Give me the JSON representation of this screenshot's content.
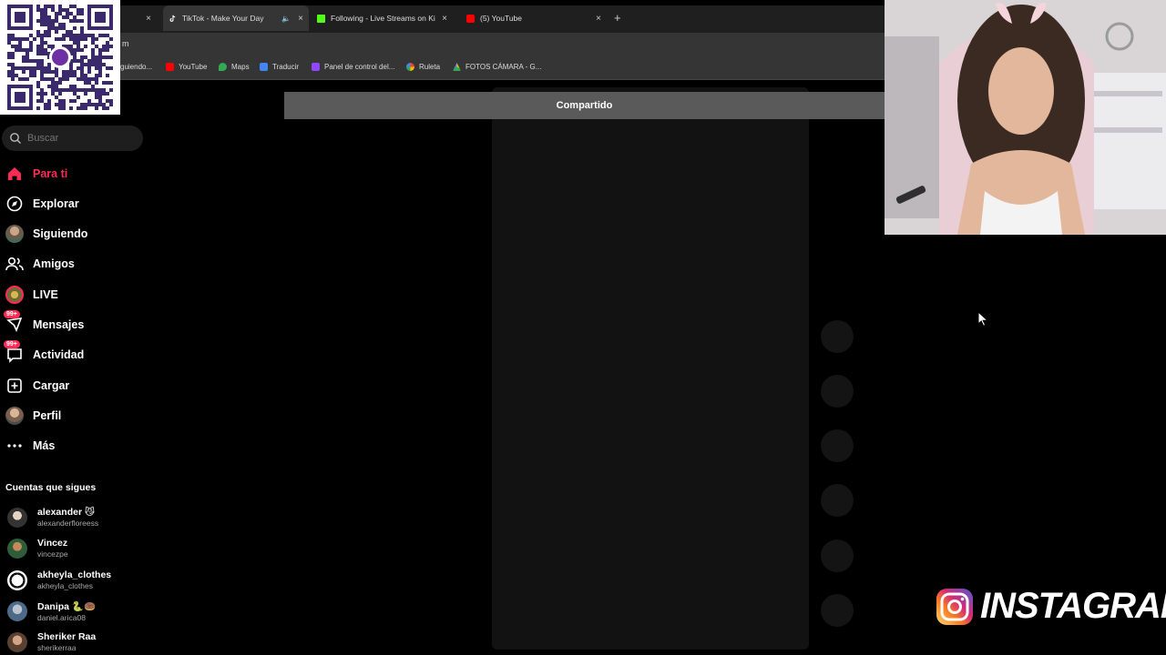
{
  "browser": {
    "tabs": [
      {
        "title": "",
        "active": false
      },
      {
        "title": "TikTok - Make Your Day",
        "active": true
      },
      {
        "title": "Following - Live Streams on Ki",
        "active": false
      },
      {
        "title": "(5) YouTube",
        "active": false
      }
    ],
    "close_glyph": "×",
    "new_tab_glyph": "+",
    "address_fragment": "m",
    "bookmarks": [
      {
        "label": "guiendo...",
        "color": "#fe2c55"
      },
      {
        "label": "YouTube",
        "color": "#ff0000"
      },
      {
        "label": "Maps",
        "color": "#34a853"
      },
      {
        "label": "Traducir",
        "color": "#4285f4"
      },
      {
        "label": "Panel de control del...",
        "color": "#9146ff"
      },
      {
        "label": "Ruleta",
        "color": "#ea4335"
      },
      {
        "label": "FOTOS CÁMARA - G...",
        "color": "#fbbc04"
      }
    ]
  },
  "sidebar": {
    "search_placeholder": "Buscar",
    "nav": [
      {
        "label": "Para ti",
        "icon": "home-icon",
        "active": true
      },
      {
        "label": "Explorar",
        "icon": "compass-icon"
      },
      {
        "label": "Siguiendo",
        "icon": "following-avatar-icon"
      },
      {
        "label": "Amigos",
        "icon": "friends-icon"
      },
      {
        "label": "LIVE",
        "icon": "live-icon"
      },
      {
        "label": "Mensajes",
        "icon": "messages-icon",
        "badge": "99+"
      },
      {
        "label": "Actividad",
        "icon": "activity-icon",
        "badge": "99+"
      },
      {
        "label": "Cargar",
        "icon": "upload-icon"
      },
      {
        "label": "Perfil",
        "icon": "profile-icon"
      },
      {
        "label": "Más",
        "icon": "more-icon"
      }
    ],
    "following_title": "Cuentas que sigues",
    "following": [
      {
        "name": "alexander 😼",
        "handle": "alexanderfloreess"
      },
      {
        "name": "Vincez",
        "handle": "vincezpe"
      },
      {
        "name": "akheyla_clothes",
        "handle": "akheyla_clothes"
      },
      {
        "name": "Danipa 🐍🍩",
        "handle": "daniel.arica08"
      },
      {
        "name": "Sheriker Raa",
        "handle": "sherikerraa"
      }
    ]
  },
  "main": {
    "shared_banner": "Compartido"
  },
  "overlay": {
    "instagram_text": "INSTAGRAM"
  },
  "colors": {
    "accent": "#fe2c55",
    "background": "#000000"
  }
}
